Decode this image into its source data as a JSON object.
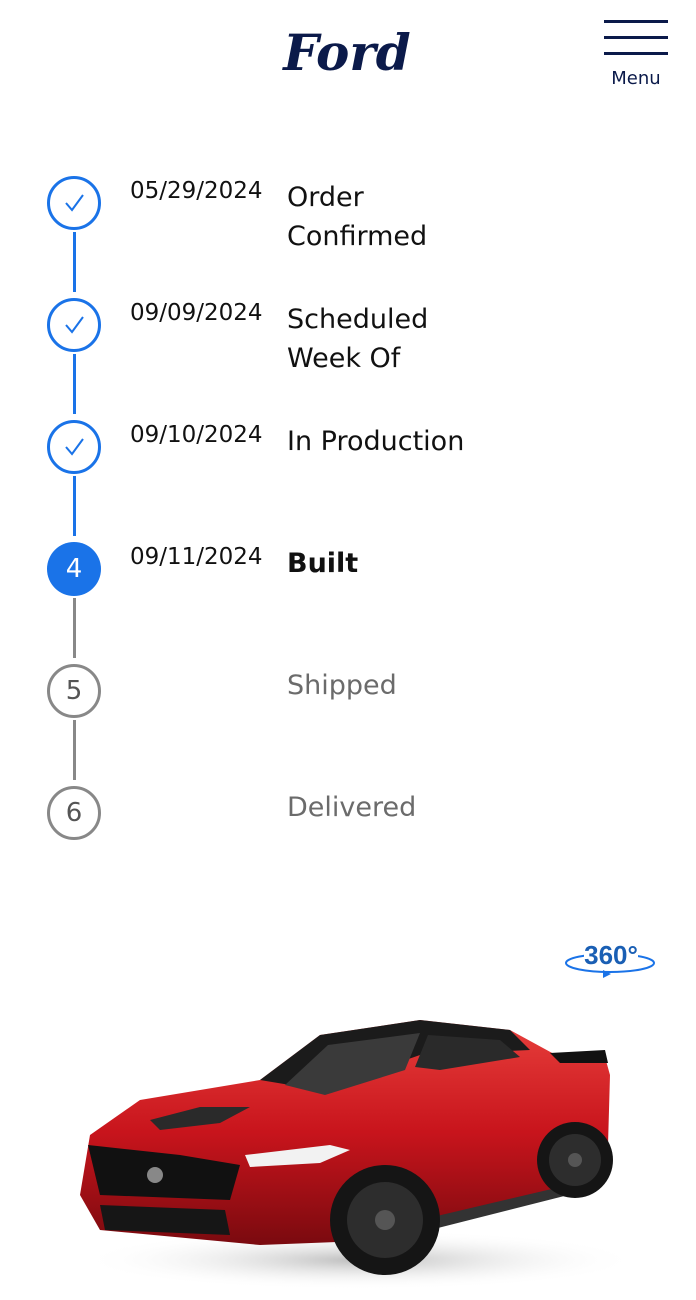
{
  "header": {
    "brand": "Ford",
    "menu_label": "Menu"
  },
  "colors": {
    "accent": "#1a73e8",
    "brand_navy": "#0b1a4a",
    "pending": "#888888",
    "car_red": "#c8141c"
  },
  "steps": [
    {
      "status": "complete",
      "icon": "checkmark-icon",
      "date": "05/29/2024",
      "title": "Order\nConfirmed"
    },
    {
      "status": "complete",
      "icon": "checkmark-icon",
      "date": "09/09/2024",
      "title": "Scheduled\nWeek Of"
    },
    {
      "status": "complete",
      "icon": "checkmark-icon",
      "date": "09/10/2024",
      "title": "In Production"
    },
    {
      "status": "current",
      "number": "4",
      "date": "09/11/2024",
      "title": "Built"
    },
    {
      "status": "pending",
      "number": "5",
      "date": "",
      "title": "Shipped"
    },
    {
      "status": "pending",
      "number": "6",
      "date": "",
      "title": "Delivered"
    }
  ],
  "viewer": {
    "label": "360°"
  }
}
